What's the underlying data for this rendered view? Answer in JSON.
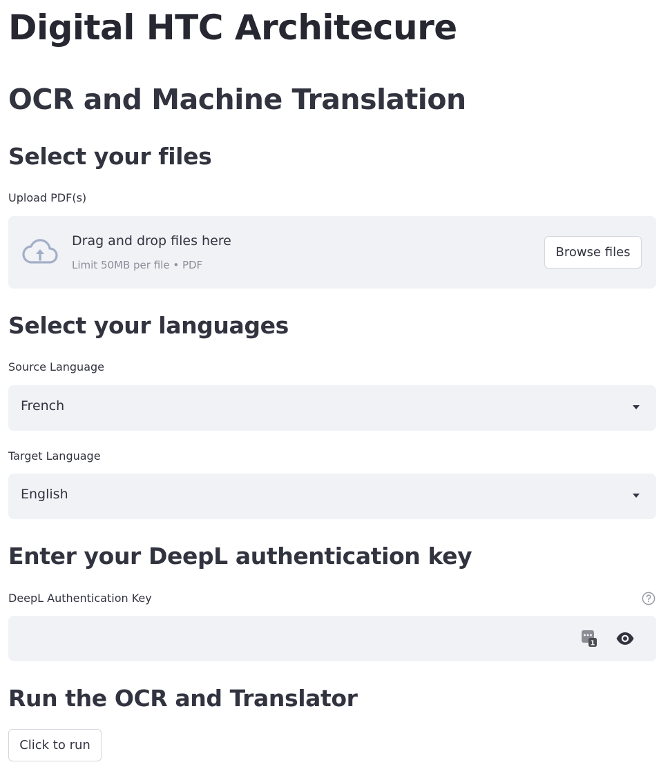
{
  "title": "Digital HTC Architecure",
  "subtitle": "OCR and Machine Translation",
  "files_section": {
    "heading": "Select your files",
    "upload_label": "Upload PDF(s)",
    "dropzone_title": "Drag and drop files here",
    "dropzone_limit": "Limit 50MB per file • PDF",
    "browse_label": "Browse files",
    "icon": "cloud-upload-icon"
  },
  "languages_section": {
    "heading": "Select your languages",
    "source_label": "Source Language",
    "source_value": "French",
    "target_label": "Target Language",
    "target_value": "English"
  },
  "auth_section": {
    "heading": "Enter your DeepL authentication key",
    "key_label": "DeepL Authentication Key",
    "key_value": "",
    "icons": [
      "help-icon",
      "password-manager-icon",
      "eye-icon"
    ]
  },
  "run_section": {
    "heading": "Run the OCR and Translator",
    "run_label": "Click to run"
  },
  "colors": {
    "text": "#31333f",
    "field_bg": "#f0f2f6",
    "muted": "#8c8f99",
    "icon_blue_gray": "#a3aec8"
  }
}
